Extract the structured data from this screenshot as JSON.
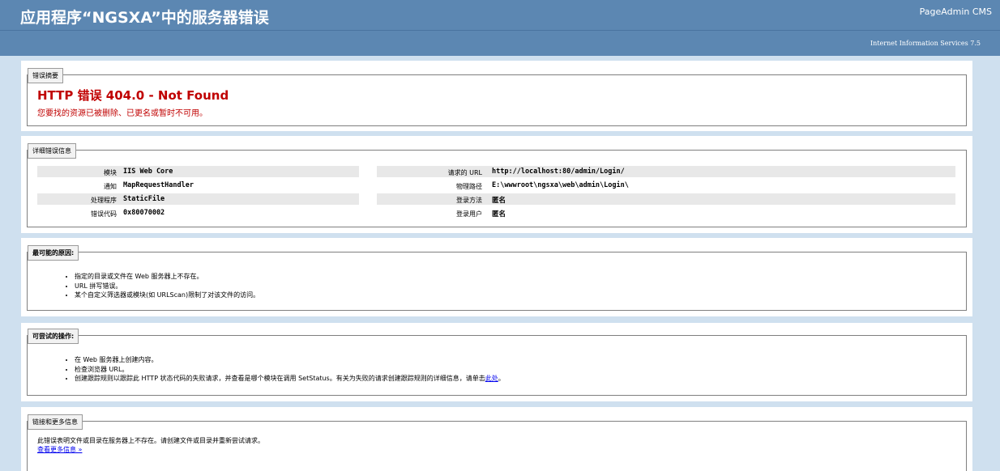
{
  "header": {
    "title": "应用程序“NGSXA”中的服务器错误",
    "cms": "PageAdmin CMS",
    "server": "Internet Information Services 7.5"
  },
  "summary": {
    "legend": "错误摘要",
    "title": "HTTP 错误 404.0 - Not Found",
    "message": "您要找的资源已被删除、已更名或暂时不可用。"
  },
  "details": {
    "legend": "详细错误信息",
    "left": [
      {
        "label": "模块",
        "value": "IIS Web Core"
      },
      {
        "label": "通知",
        "value": "MapRequestHandler"
      },
      {
        "label": "处理程序",
        "value": "StaticFile"
      },
      {
        "label": "错误代码",
        "value": "0x80070002"
      }
    ],
    "right": [
      {
        "label": "请求的 URL",
        "value": "http://localhost:80/admin/Login/"
      },
      {
        "label": "物理路径",
        "value": "E:\\wwwroot\\ngsxa\\web\\admin\\Login\\"
      },
      {
        "label": "登录方法",
        "value": "匿名"
      },
      {
        "label": "登录用户",
        "value": "匿名"
      }
    ]
  },
  "causes": {
    "legend": "最可能的原因:",
    "items": [
      "指定的目录或文件在 Web 服务器上不存在。",
      "URL 拼写错误。",
      "某个自定义筛选器或模块(如 URLScan)限制了对该文件的访问。"
    ]
  },
  "actions": {
    "legend": "可尝试的操作:",
    "items": [
      "在 Web 服务器上创建内容。",
      "检查浏览器 URL。"
    ],
    "item3_text": "创建跟踪规则以跟踪此 HTTP 状态代码的失败请求，并查看是哪个模块在调用 SetStatus。有关为失败的请求创建跟踪规则的详细信息，请单击",
    "item3_link": "此处",
    "item3_end": "。"
  },
  "more": {
    "legend": "链接和更多信息",
    "text": "此错误表明文件或目录在服务器上不存在。请创建文件或目录并重新尝试请求。",
    "link": "查看更多信息 »"
  }
}
